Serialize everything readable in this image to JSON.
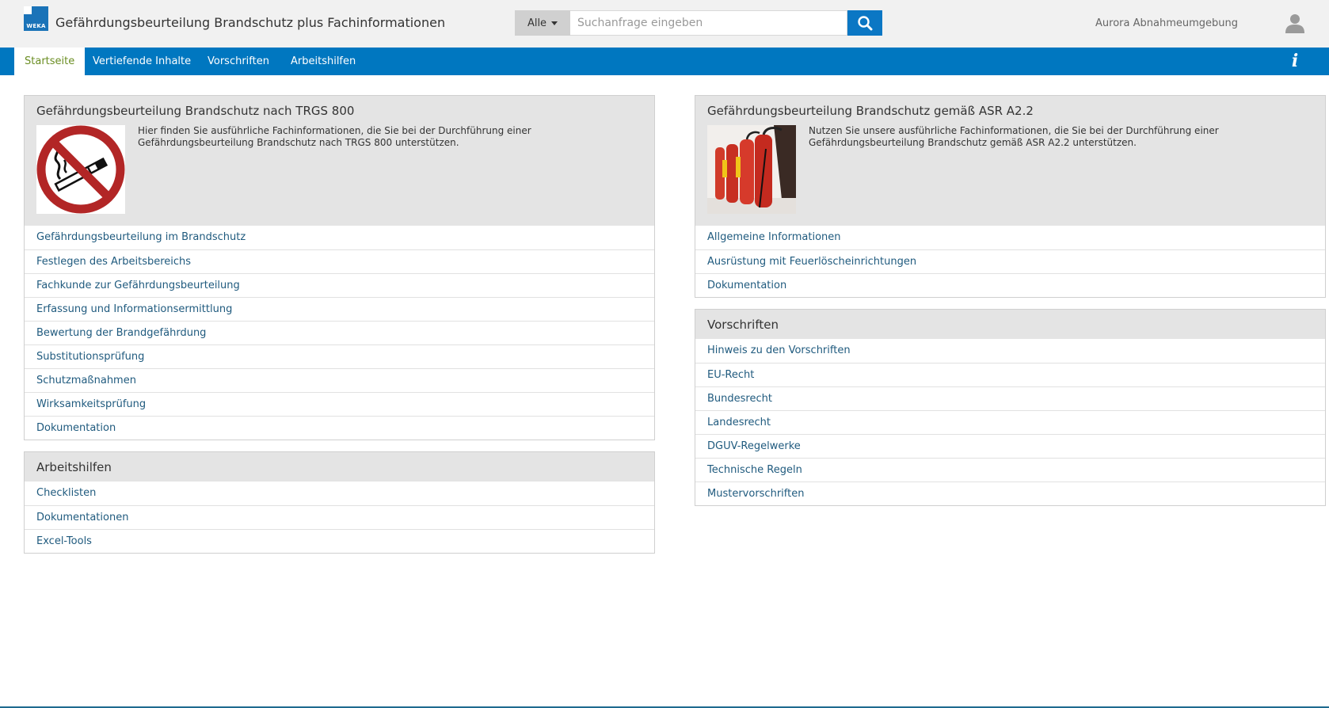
{
  "brand": {
    "logo_text": "WEKA"
  },
  "header": {
    "app_title": "Gefährdungsbeurteilung Brandschutz plus Fachinformationen",
    "search_scope": "Alle",
    "search_placeholder": "Suchanfrage eingeben",
    "user_name": "Aurora Abnahmeumgebung",
    "search_icon": "search-icon",
    "user_icon": "user-avatar-icon"
  },
  "nav": {
    "items": [
      {
        "label": "Startseite",
        "active": true
      },
      {
        "label": "Vertiefende Inhalte",
        "active": false
      },
      {
        "label": "Vorschriften",
        "active": false
      },
      {
        "label": "Arbeitshilfen",
        "active": false
      }
    ],
    "info_label": "i"
  },
  "panels": {
    "trgs": {
      "title": "Gefährdungsbeurteilung Brandschutz nach TRGS 800",
      "description": "Hier finden Sie ausführliche Fachinformationen, die Sie bei der Durchführung einer Gefährdungsbeurteilung Brandschutz nach TRGS 800 unterstützen.",
      "image": "no-smoking-sign",
      "links": [
        "Gefährdungsbeurteilung im Brandschutz",
        "Festlegen des Arbeitsbereichs",
        "Fachkunde zur Gefährdungsbeurteilung",
        "Erfassung und Informationsermittlung",
        "Bewertung der Brandgefährdung",
        "Substitutionsprüfung",
        "Schutzmaßnahmen",
        "Wirksamkeitsprüfung",
        "Dokumentation"
      ]
    },
    "asr": {
      "title": "Gefährdungsbeurteilung Brandschutz gemäß ASR A2.2",
      "description": "Nutzen Sie unsere ausführliche Fachinformationen, die Sie bei der Durchführung einer Gefährdungsbeurteilung Brandschutz gemäß ASR A2.2 unterstützen.",
      "image": "fire-extinguishers-photo",
      "links": [
        "Allgemeine Informationen",
        "Ausrüstung mit Feuerlöscheinrichtungen",
        "Dokumentation"
      ]
    },
    "arbeitshilfen": {
      "title": "Arbeitshilfen",
      "links": [
        "Checklisten",
        "Dokumentationen",
        "Excel-Tools"
      ]
    },
    "vorschriften": {
      "title": "Vorschriften",
      "links": [
        "Hinweis zu den Vorschriften",
        "EU-Recht",
        "Bundesrecht",
        "Landesrecht",
        "DGUV-Regelwerke",
        "Technische Regeln",
        "Mustervorschriften"
      ]
    }
  },
  "colors": {
    "nav_bar": "#0077c0",
    "search_button": "#0b77c4",
    "active_tab_text": "#6b8e23",
    "link_text": "#1f5a7e",
    "panel_header": "#e4e4e4"
  }
}
